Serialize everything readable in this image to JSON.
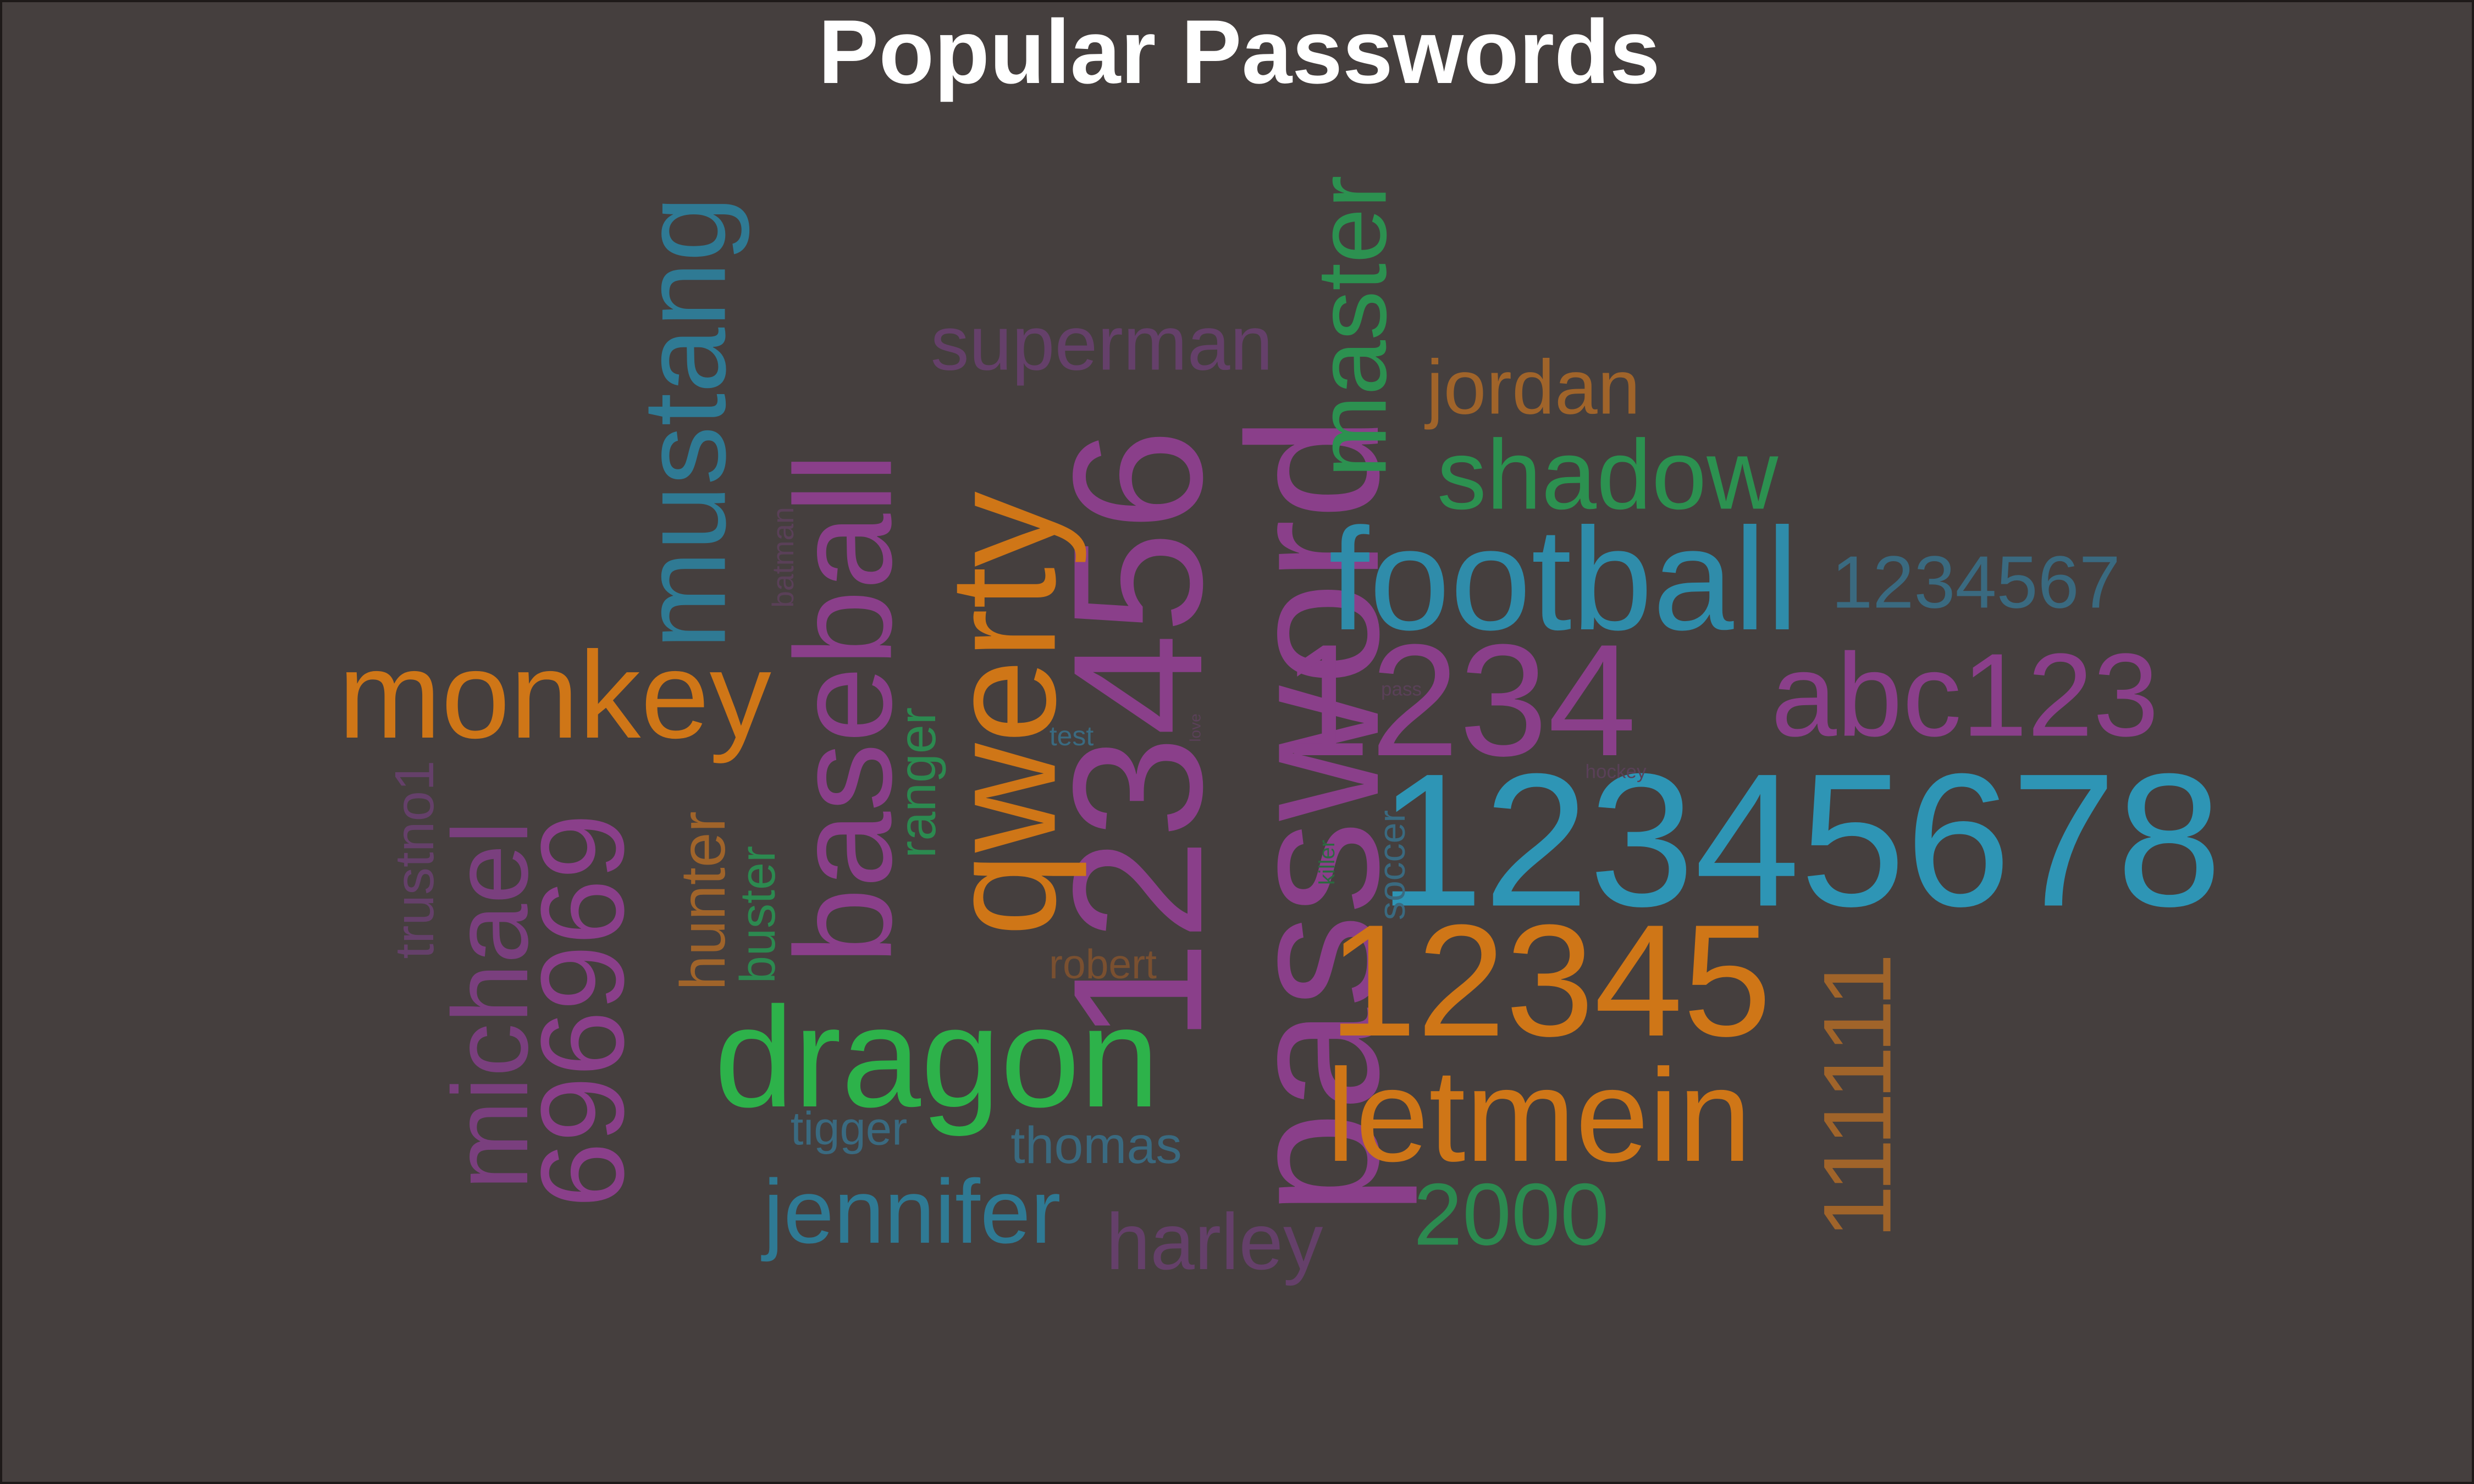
{
  "chart_data": {
    "type": "wordcloud",
    "title": "Popular Passwords",
    "background": "#453f3e",
    "palette": {
      "purple": "#8a3f8a",
      "orange": "#cf7617",
      "teal": "#2e95b5",
      "blue_teal": "#2f7a94",
      "slate": "#3a6a80",
      "green": "#2db24a",
      "green_dark": "#2c9150",
      "brown": "#a0642a",
      "plum": "#65406a"
    },
    "words": [
      {
        "text": "password",
        "color": "#8a3f8a",
        "rotated": true
      },
      {
        "text": "12345678",
        "color": "#2e95b5",
        "rotated": false
      },
      {
        "text": "123456",
        "color": "#8a3f8a",
        "rotated": true
      },
      {
        "text": "qwerty",
        "color": "#cf7617",
        "rotated": true
      },
      {
        "text": "baseball",
        "color": "#8a3f8a",
        "rotated": true
      },
      {
        "text": "dragon",
        "color": "#2db24a",
        "rotated": false
      },
      {
        "text": "football",
        "color": "#2f8caa",
        "rotated": false
      },
      {
        "text": "12345",
        "color": "#cf7617",
        "rotated": false
      },
      {
        "text": "1234",
        "color": "#8a3f8a",
        "rotated": false
      },
      {
        "text": "letmein",
        "color": "#cf7617",
        "rotated": false
      },
      {
        "text": "monkey",
        "color": "#cf7617",
        "rotated": false
      },
      {
        "text": "mustang",
        "color": "#2f7a94",
        "rotated": true
      },
      {
        "text": "696969",
        "color": "#8a3f8a",
        "rotated": true
      },
      {
        "text": "michael",
        "color": "#7a3f7e",
        "rotated": true
      },
      {
        "text": "abc123",
        "color": "#8a3f8a",
        "rotated": false
      },
      {
        "text": "master",
        "color": "#2c9150",
        "rotated": true
      },
      {
        "text": "shadow",
        "color": "#2c9150",
        "rotated": false
      },
      {
        "text": "111111",
        "color": "#a0642a",
        "rotated": true
      },
      {
        "text": "jennifer",
        "color": "#2f7a94",
        "rotated": false
      },
      {
        "text": "jordan",
        "color": "#a0642a",
        "rotated": false
      },
      {
        "text": "superman",
        "color": "#65406a",
        "rotated": false
      },
      {
        "text": "2000",
        "color": "#2c8a50",
        "rotated": false
      },
      {
        "text": "harley",
        "color": "#65406a",
        "rotated": false
      },
      {
        "text": "1234567",
        "color": "#3a6a80",
        "rotated": false
      },
      {
        "text": "hunter",
        "color": "#a0642a",
        "rotated": true
      },
      {
        "text": "trustno1",
        "color": "#65406a",
        "rotated": true
      },
      {
        "text": "ranger",
        "color": "#2c8a50",
        "rotated": true
      },
      {
        "text": "buster",
        "color": "#2c8a50",
        "rotated": true
      },
      {
        "text": "thomas",
        "color": "#3a6a80",
        "rotated": false
      },
      {
        "text": "tigger",
        "color": "#3a6a80",
        "rotated": false
      },
      {
        "text": "robert",
        "color": "#7a5030",
        "rotated": false
      },
      {
        "text": "soccer",
        "color": "#3a6a80",
        "rotated": true
      },
      {
        "text": "batman",
        "color": "#5a4058",
        "rotated": true
      },
      {
        "text": "test",
        "color": "#3a6a80",
        "rotated": false
      },
      {
        "text": "pass",
        "color": "#5a4058",
        "rotated": false
      },
      {
        "text": "killer",
        "color": "#2c6a40",
        "rotated": true
      },
      {
        "text": "hockey",
        "color": "#5a4058",
        "rotated": false
      },
      {
        "text": "love",
        "color": "#5a4058",
        "rotated": true
      }
    ]
  }
}
